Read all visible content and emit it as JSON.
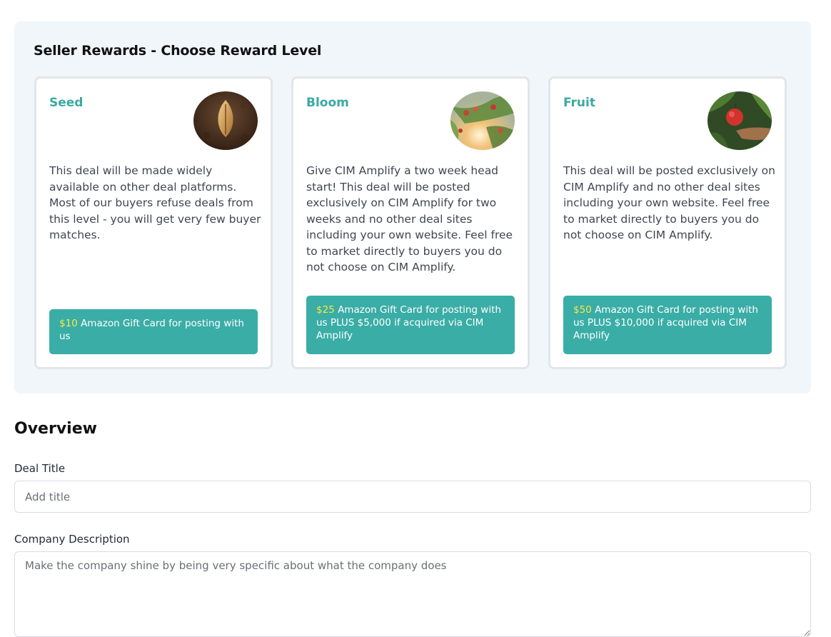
{
  "rewards": {
    "title": "Seller Rewards - Choose Reward Level",
    "cards": [
      {
        "name": "Seed",
        "image_icon": "seed-image",
        "description": "This deal will be made widely available on other deal platforms. Most of our buyers refuse deals from this level - you will get very few buyer matches.",
        "reward_amount": "$10",
        "reward_text": " Amazon Gift Card for posting with us"
      },
      {
        "name": "Bloom",
        "image_icon": "bloom-image",
        "description": "Give CIM Amplify a two week head start! This deal will be posted exclusively on CIM Amplify for two weeks and no other deal sites including your own website. Feel free to market directly to buyers you do not choose on CIM Amplify.",
        "reward_amount": "$25",
        "reward_text": " Amazon Gift Card for posting with us PLUS $5,000 if acquired via CIM Amplify"
      },
      {
        "name": "Fruit",
        "image_icon": "fruit-image",
        "description": "This deal will be posted exclusively on CIM Amplify and no other deal sites including your own website. Feel free to market directly to buyers you do not choose on CIM Amplify.",
        "reward_amount": "$50",
        "reward_text": " Amazon Gift Card for posting with us PLUS $10,000 if acquired via CIM Amplify"
      }
    ]
  },
  "overview": {
    "heading": "Overview",
    "deal_title_label": "Deal Title",
    "deal_title_placeholder": "Add title",
    "deal_title_value": "",
    "company_description_label": "Company Description",
    "company_description_placeholder": "Make the company shine by being very specific about what the company does",
    "company_description_value": ""
  },
  "colors": {
    "accent": "#3aa9a3",
    "reward_box": "#3aada6",
    "reward_amount": "#f7e94a",
    "panel_bg": "#f0f6f9"
  }
}
